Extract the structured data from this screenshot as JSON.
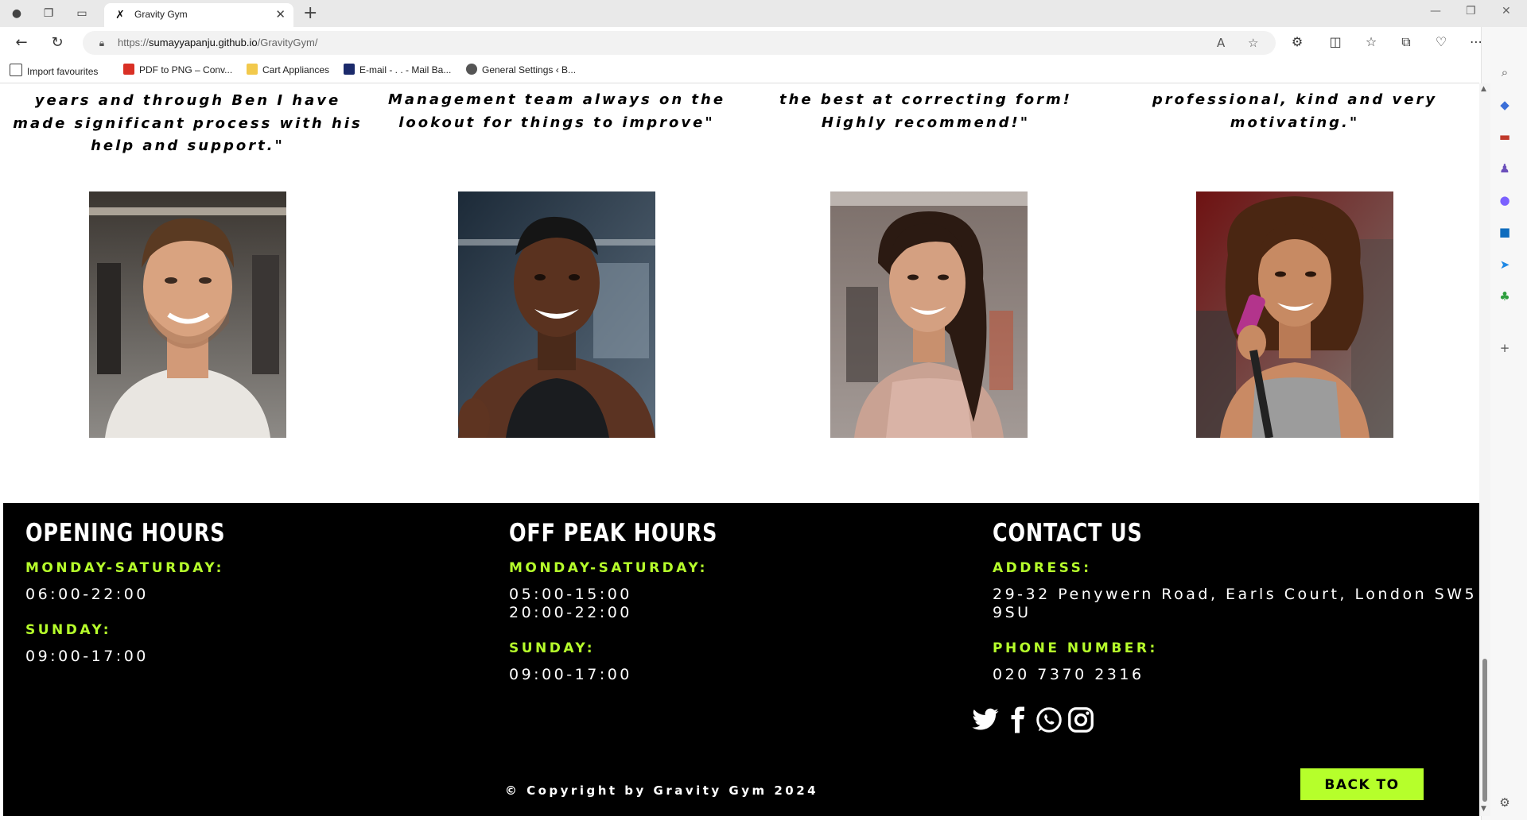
{
  "browser": {
    "tab_title": "Gravity Gym",
    "url_prefix": "https://",
    "url_domain": "sumayyapanju.github.io",
    "url_path": "/GravityGym/",
    "bookmarks": [
      {
        "label": "Import favourites",
        "icon": "import-icon"
      },
      {
        "label": "PDF to PNG – Conv...",
        "icon": "pdf-icon"
      },
      {
        "label": "Cart Appliances",
        "icon": "folder-icon"
      },
      {
        "label": "E-mail - . . - Mail Ba...",
        "icon": "mail-icon"
      },
      {
        "label": "General Settings ‹ B...",
        "icon": "wordpress-icon"
      }
    ]
  },
  "testimonials": [
    {
      "quote": "years and through Ben I have made significant process with his help and support.\"",
      "photo": "man-white-tshirt-gym"
    },
    {
      "quote": "Management team always on the lookout for things to improve\"",
      "photo": "man-black-tank-gym"
    },
    {
      "quote": "the best at correcting form! Highly recommend!\"",
      "photo": "woman-pink-top-gym"
    },
    {
      "quote": "professional, kind and very motivating.\"",
      "photo": "woman-grey-top-gym"
    }
  ],
  "footer": {
    "opening": {
      "heading": "OPENING HOURS",
      "label1": "MONDAY-SATURDAY:",
      "value1": "06:00-22:00",
      "label2": "SUNDAY:",
      "value2": "09:00-17:00"
    },
    "offpeak": {
      "heading": "OFF PEAK HOURS",
      "label1": "MONDAY-SATURDAY:",
      "value1a": "05:00-15:00",
      "value1b": "20:00-22:00",
      "label2": "SUNDAY:",
      "value2": "09:00-17:00"
    },
    "contact": {
      "heading": "CONTACT US",
      "address_label": "ADDRESS:",
      "address_line1": "29-32 Penywern Road, Earls Court, London SW5",
      "address_line2": "9SU",
      "phone_label": "PHONE NUMBER:",
      "phone": "020 7370 2316"
    },
    "socials": [
      "twitter-icon",
      "facebook-icon",
      "whatsapp-icon",
      "instagram-icon"
    ],
    "copyright": "© Copyright by Gravity Gym 2024",
    "back_to_top": "BACK TO TOP"
  },
  "colors": {
    "accent": "#b6ff2b",
    "footer_bg": "#000000"
  }
}
